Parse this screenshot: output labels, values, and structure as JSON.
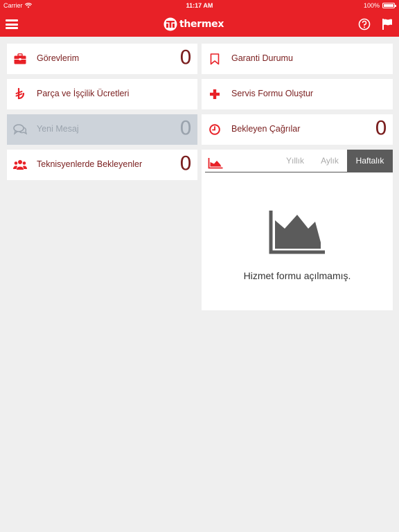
{
  "status_bar": {
    "carrier": "Carrier",
    "time": "11:17 AM",
    "battery": "100%"
  },
  "nav": {
    "logo_text": "thermex"
  },
  "tiles": {
    "tasks": {
      "label": "Görevlerim",
      "count": "0"
    },
    "parts_labor": {
      "label": "Parça ve İşçilik Ücretleri"
    },
    "new_message": {
      "label": "Yeni Mesaj",
      "count": "0"
    },
    "awaiting_technicians": {
      "label": "Teknisyenlerde Bekleyenler",
      "count": "0"
    },
    "warranty_status": {
      "label": "Garanti Durumu"
    },
    "create_service_form": {
      "label": "Servis Formu Oluştur"
    },
    "pending_calls": {
      "label": "Bekleyen Çağrılar",
      "count": "0"
    }
  },
  "chart_card": {
    "tabs": [
      "Yıllık",
      "Aylık",
      "Haftalık"
    ],
    "active_tab": "Haftalık",
    "empty_message": "Hizmet formu açılmamış."
  },
  "colors": {
    "brand": "#e82127",
    "text": "#7a1e1e",
    "disabled_bg": "#cdd3da",
    "active_tab": "#5b5b5b",
    "background": "#efefef"
  },
  "icons": {
    "tasks": "briefcase-icon",
    "parts_labor": "lira-icon",
    "new_message": "chat-icon",
    "awaiting_technicians": "users-icon",
    "warranty_status": "bookmark-icon",
    "create_service_form": "plus-icon",
    "pending_calls": "clock-icon",
    "chart": "area-chart-icon"
  }
}
